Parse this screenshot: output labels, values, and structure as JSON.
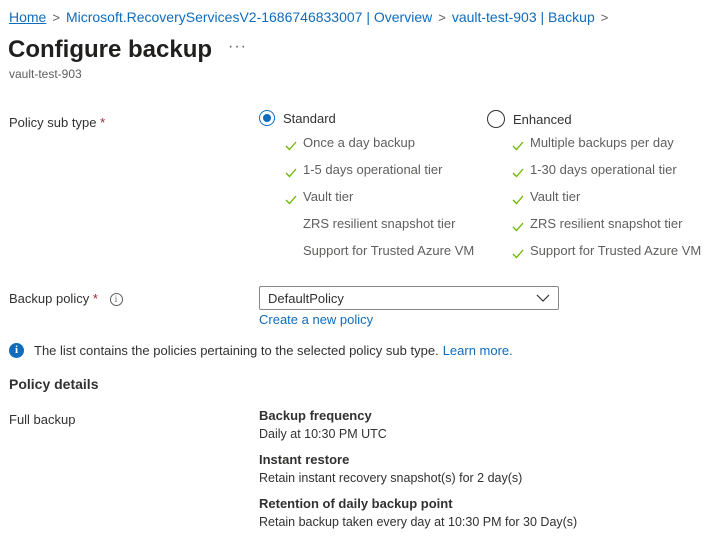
{
  "breadcrumb": [
    {
      "label": "Home"
    },
    {
      "label": "Microsoft.RecoveryServicesV2-1686746833007 | Overview"
    },
    {
      "label": "vault-test-903 | Backup"
    }
  ],
  "header": {
    "title": "Configure backup",
    "more_label": "···",
    "subtitle": "vault-test-903"
  },
  "policy_sub_type": {
    "label": "Policy sub type",
    "required_marker": "*",
    "options": [
      {
        "label": "Standard",
        "selected": true,
        "features": [
          {
            "text": "Once a day backup",
            "checked": true
          },
          {
            "text": "1-5 days operational tier",
            "checked": true
          },
          {
            "text": "Vault tier",
            "checked": true
          },
          {
            "text": "ZRS resilient snapshot tier",
            "checked": false
          },
          {
            "text": "Support for Trusted Azure VM",
            "checked": false
          }
        ]
      },
      {
        "label": "Enhanced",
        "selected": false,
        "features": [
          {
            "text": "Multiple backups per day",
            "checked": true
          },
          {
            "text": "1-30 days operational tier",
            "checked": true
          },
          {
            "text": "Vault tier",
            "checked": true
          },
          {
            "text": "ZRS resilient snapshot tier",
            "checked": true
          },
          {
            "text": "Support for Trusted Azure VM",
            "checked": true
          }
        ]
      }
    ]
  },
  "backup_policy": {
    "label": "Backup policy",
    "required_marker": "*",
    "selected_value": "DefaultPolicy",
    "create_link": "Create a new policy"
  },
  "info_banner": {
    "text": "The list contains the policies pertaining to the selected policy sub type.",
    "link": "Learn more."
  },
  "policy_details": {
    "title": "Policy details",
    "row_label": "Full backup",
    "items": [
      {
        "heading": "Backup frequency",
        "value": "Daily at 10:30 PM UTC"
      },
      {
        "heading": "Instant restore",
        "value": "Retain instant recovery snapshot(s) for 2 day(s)"
      },
      {
        "heading": "Retention of daily backup point",
        "value": "Retain backup taken every day at 10:30 PM for 30 Day(s)"
      }
    ]
  },
  "colors": {
    "accent": "#0f6cbd",
    "check": "#6bb700",
    "required": "#a4262c"
  }
}
